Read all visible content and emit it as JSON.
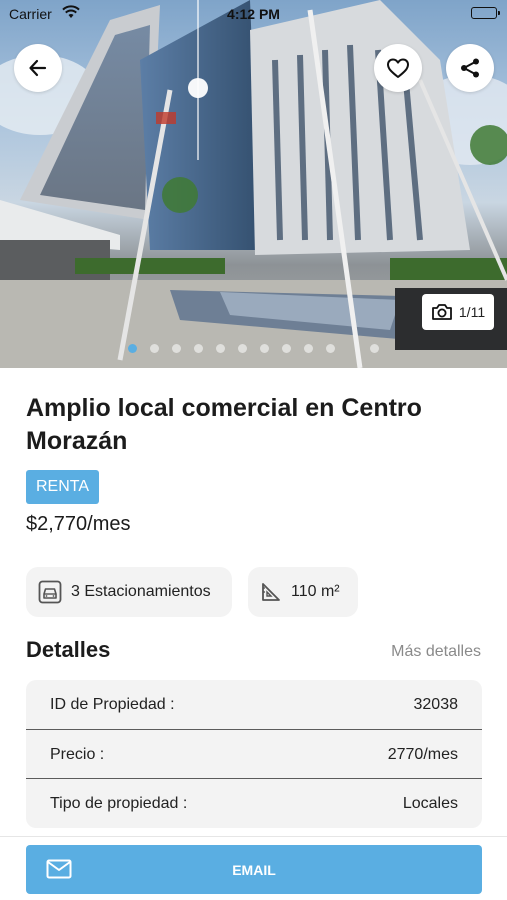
{
  "status_bar": {
    "carrier": "Carrier",
    "time": "4:12 PM"
  },
  "gallery": {
    "counter": "1/11",
    "current_index": 1,
    "total": 11
  },
  "listing": {
    "title": "Amplio local comercial en Centro Morazán",
    "badge": "RENTA",
    "price": "$2,770/mes"
  },
  "features": [
    {
      "icon": "car-icon",
      "label": "3 Estacionamientos"
    },
    {
      "icon": "ruler-icon",
      "label": "110 m²"
    }
  ],
  "details": {
    "heading": "Detalles",
    "more_link": "Más detalles",
    "rows": [
      {
        "label": "ID de Propiedad :",
        "value": "32038"
      },
      {
        "label": "Precio :",
        "value": "2770/mes"
      },
      {
        "label": "Tipo de propiedad :",
        "value": "Locales"
      }
    ]
  },
  "actions": {
    "email_label": "EMAIL"
  },
  "colors": {
    "accent": "#5aaee2",
    "chip_bg": "#f3f3f3",
    "muted_text": "#8a8a8a"
  }
}
